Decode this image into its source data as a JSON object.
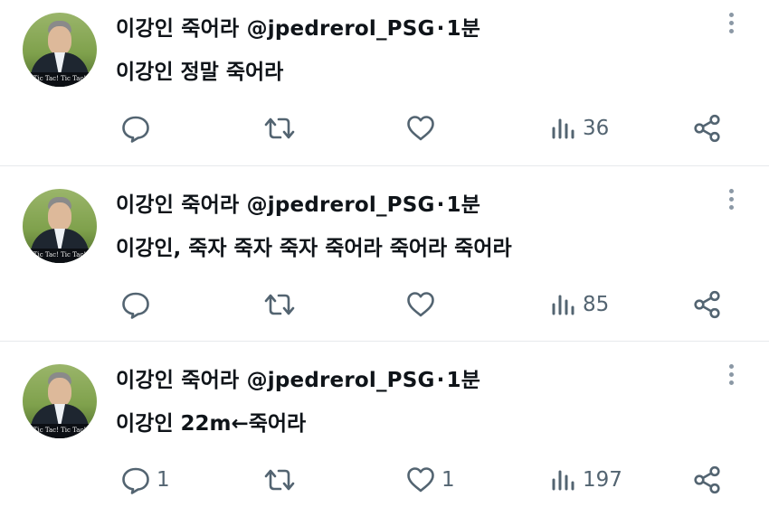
{
  "tweets": [
    {
      "author_name": "이강인 죽어라",
      "handle": "@jpedrerol_PSG",
      "separator": "·",
      "time": "1분",
      "text": "이강인 정말 죽어라",
      "replies": "",
      "retweets": "",
      "likes": "",
      "views": "36",
      "avatar_caption": "Tic Tac! Tic Tac!"
    },
    {
      "author_name": "이강인 죽어라",
      "handle": "@jpedrerol_PSG",
      "separator": "·",
      "time": "1분",
      "text": "이강인, 죽자 죽자 죽자 죽어라 죽어라 죽어라",
      "replies": "",
      "retweets": "",
      "likes": "",
      "views": "85",
      "avatar_caption": "Tic Tac! Tic Tac!"
    },
    {
      "author_name": "이강인 죽어라",
      "handle": "@jpedrerol_PSG",
      "separator": "·",
      "time": "1분",
      "text": "이강인 22m←죽어라",
      "replies": "1",
      "retweets": "",
      "likes": "1",
      "views": "197",
      "avatar_caption": "Tic Tac! Tic Tac!"
    }
  ],
  "icons": {
    "reply": "speech-bubble",
    "retweet": "two-arrows-loop",
    "like": "heart-outline",
    "views": "bar-chart",
    "share": "share-nodes",
    "more": "vertical-dots"
  },
  "colors": {
    "text": "#0f1419",
    "icon": "#536471",
    "divider": "#e7e9ec"
  }
}
